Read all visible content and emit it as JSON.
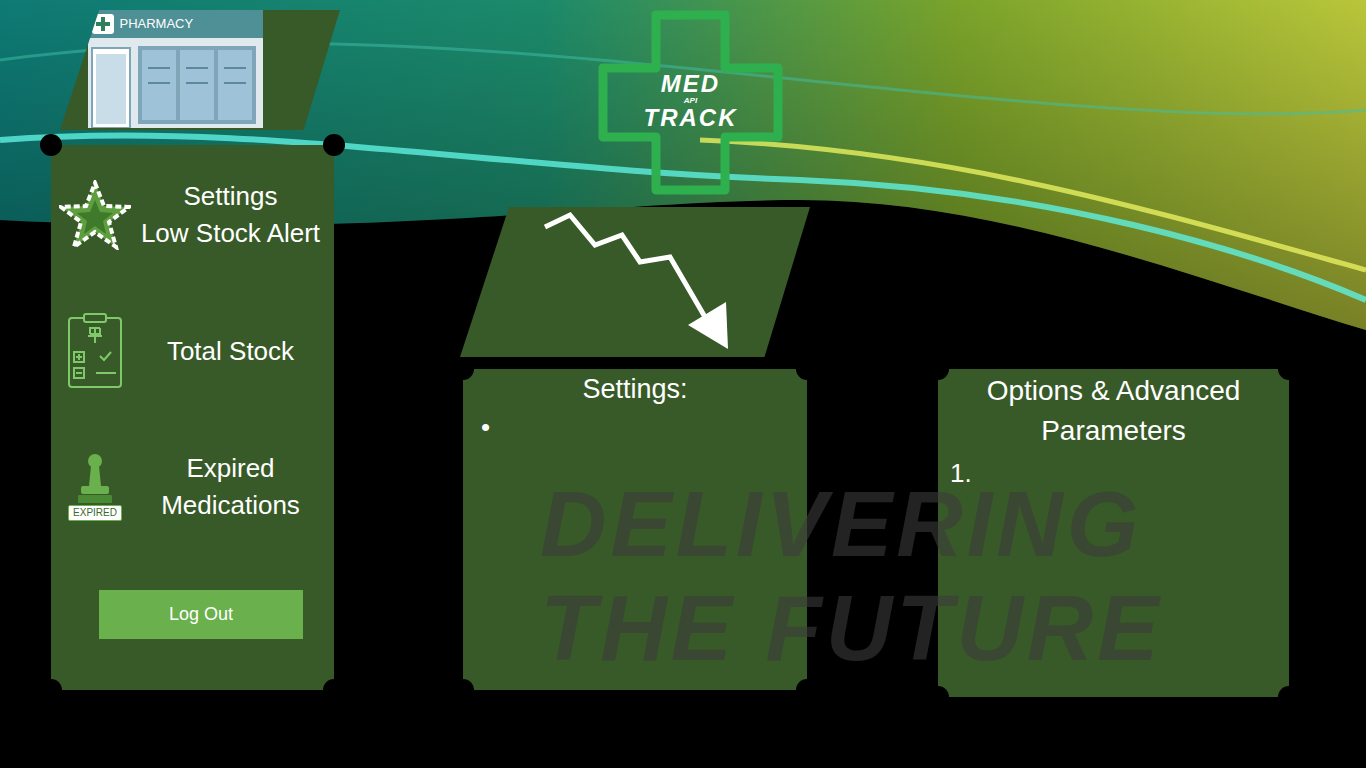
{
  "brand": {
    "sign": "PHARMACY"
  },
  "logo": {
    "top": "MED",
    "middle": "API",
    "bottom": "TRACK"
  },
  "sidebar": {
    "items": [
      {
        "kind": "star",
        "lines": [
          "Settings",
          "Low Stock Alert"
        ]
      },
      {
        "kind": "clipboard",
        "lines": [
          "Total Stock"
        ]
      },
      {
        "kind": "stamp",
        "lines": [
          "Expired",
          "Medications"
        ],
        "badge": "EXPIRED"
      }
    ],
    "logout_button": "Log Out"
  },
  "settings_panel": {
    "title": "Settings:",
    "items": [
      "•"
    ]
  },
  "options_panel": {
    "title": "Options & Advanced Parameters",
    "items": [
      "1."
    ]
  },
  "watermark": [
    "DELIVERING",
    "THE FUTURE"
  ]
}
